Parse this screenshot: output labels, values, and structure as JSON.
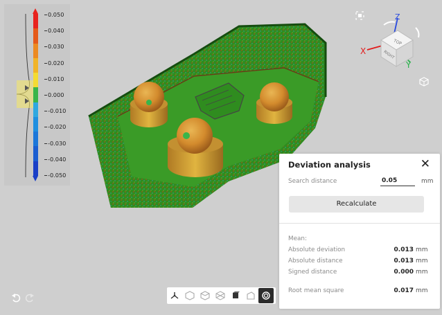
{
  "legend": {
    "labels": [
      "0.050",
      "0.040",
      "0.030",
      "0.020",
      "0.010",
      "0.000",
      "-0.010",
      "-0.020",
      "-0.030",
      "-0.040",
      "-0.050"
    ],
    "colors": [
      "#e8231e",
      "#e55a1a",
      "#ec8a22",
      "#f1b428",
      "#f4db33",
      "#39b54a",
      "#2fa8e0",
      "#1f8fe0",
      "#1c77d9",
      "#1b5ed1",
      "#1a3fc7"
    ]
  },
  "view_cube": {
    "axis_x": "X",
    "axis_y": "Y",
    "axis_z": "Z",
    "face_top": "TOP",
    "face_right": "RIGHT"
  },
  "panel": {
    "title": "Deviation analysis",
    "close": "✕",
    "search_label": "Search distance",
    "search_value": "0.05",
    "search_unit": "mm",
    "recalc_label": "Recalculate",
    "mean_label": "Mean:",
    "rows": [
      {
        "label": "Absolute deviation",
        "value": "0.013",
        "unit": "mm"
      },
      {
        "label": "Absolute distance",
        "value": "0.013",
        "unit": "mm"
      },
      {
        "label": "Signed distance",
        "value": "0.000",
        "unit": "mm"
      }
    ],
    "rms": {
      "label": "Root mean square",
      "value": "0.017",
      "unit": "mm"
    }
  },
  "toolbar": {
    "items": [
      "axes-icon",
      "solid-view-icon",
      "shaded-view-icon",
      "wireframe-view-icon",
      "box-view-icon",
      "section-view-icon",
      "deviation-map-icon"
    ],
    "active": "deviation-map-icon"
  },
  "colors": {
    "background": "#cfcfcf",
    "part_green": "#2e8f1f",
    "sphere_orange": "#d79a32",
    "axis_x": "#e21b1b",
    "axis_y": "#27b24a",
    "axis_z": "#2a4be0"
  }
}
